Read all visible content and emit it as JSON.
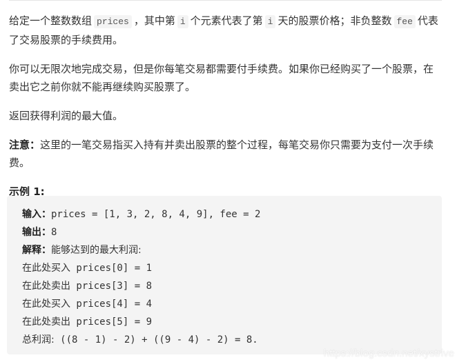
{
  "problem": {
    "p1": {
      "t1": "给定一个整数数组",
      "code1": "prices",
      "t2": "，其中第",
      "code2": "i",
      "t3": "个元素代表了第",
      "code3": "i",
      "t4": "天的股票价格；非负整数",
      "code4": "fee",
      "t5": "代表了交易股票的手续费用。"
    },
    "p2": "你可以无限次地完成交易，但是你每笔交易都需要付手续费。如果你已经购买了一个股票，在卖出它之前你就不能再继续购买股票了。",
    "p3": "返回获得利润的最大值。",
    "note_label": "注意：",
    "note_text": "这里的一笔交易指买入持有并卖出股票的整个过程，每笔交易你只需要为支付一次手续费。",
    "example_title": "示例 1:"
  },
  "example": {
    "input_label": "输入：",
    "input_value": "prices = [1, 3, 2, 8, 4, 9], fee = 2",
    "output_label": "输出：",
    "output_value": "8",
    "explain_label": "解释：",
    "explain_value": "能够达到的最大利润:",
    "steps": [
      {
        "action": "在此处买入",
        "expr": " prices[0] = 1"
      },
      {
        "action": "在此处卖出",
        "expr": " prices[3] = 8"
      },
      {
        "action": "在此处买入",
        "expr": " prices[4] = 4"
      },
      {
        "action": "在此处卖出",
        "expr": " prices[5] = 9"
      }
    ],
    "total_label": "总利润:",
    "total_expr": " ((8 - 1) - 2) + ((9 - 4) - 2) = 8."
  },
  "watermark": "https://blog.csdn.net/xystrive"
}
